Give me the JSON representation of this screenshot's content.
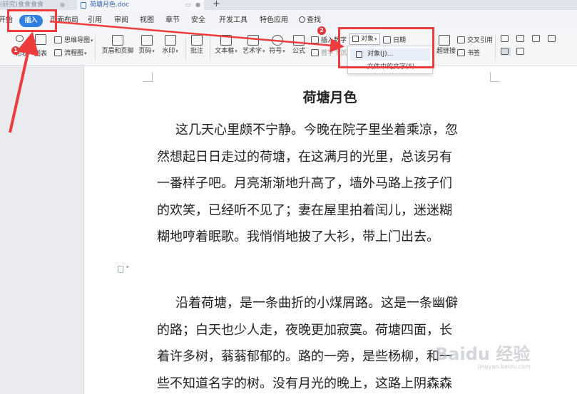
{
  "tabs": [
    {
      "label": "(研究)食食食食",
      "active": false
    },
    {
      "label": "荷塘月色.doc",
      "active": true
    }
  ],
  "ribbon_tabs": [
    "开始",
    "插入",
    "页面布局",
    "引用",
    "审阅",
    "视图",
    "章节",
    "安全",
    "开发工具",
    "特色应用",
    "查找"
  ],
  "toolbar": {
    "mindmap": "思维导图",
    "flowchart": "流程图",
    "icons": "图表",
    "shapes": "形状",
    "header_footer": "页眉和页脚",
    "page_number": "页码",
    "watermark": "水印",
    "comment": "批注",
    "textbox": "文本框",
    "wordart": "艺术字",
    "symbol": "符号",
    "formula": "公式",
    "insert_number": "插入数字",
    "first_letter": "首字下沉",
    "object": "对象",
    "date": "日期",
    "hyperlink": "超链接",
    "cross_ref": "交叉引用",
    "bookmark": "书签"
  },
  "object_menu": {
    "item_object": "对象(J)...",
    "item_text_from_file": "文件中的文字(F)..."
  },
  "document": {
    "title": "荷塘月色",
    "para1_lines": [
      "这几天心里颇不宁静。今晚在院子里坐着乘凉，忽",
      "然想起日日走过的荷塘，在这满月的光里，总该另有",
      "一番样子吧。月亮渐渐地升高了，墙外马路上孩子们",
      "的欢笑，已经听不见了；妻在屋里拍着闰儿，迷迷糊",
      "糊地哼着眠歌。我悄悄地披了大衫，带上门出去。"
    ],
    "para2_lines": [
      "沿着荷塘，是一条曲折的小煤屑路。这是一条幽僻",
      "的路；白天也少人走，夜晚更加寂寞。荷塘四面，长",
      "着许多树，蓊蓊郁郁的。路的一旁，是些杨柳，和一",
      "些不知道名字的树。没有月光的晚上，这路上阴森森"
    ]
  },
  "annotations": {
    "step1": "1",
    "step2": "2",
    "color": "#ee3b3b"
  },
  "watermark": {
    "text": "Baidu 经验",
    "sub": "jingyan.baidu.com"
  },
  "colors": {
    "accent": "#2f7fe0",
    "highlight": "#ee3b3b"
  }
}
